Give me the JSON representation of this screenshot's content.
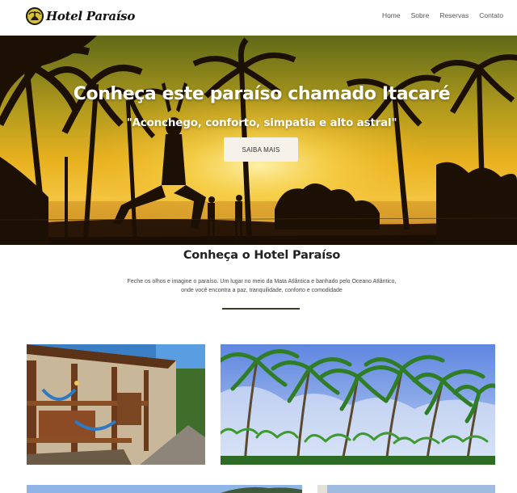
{
  "brand": {
    "name": "Hotel Paraíso",
    "logo_icon": "palm-tree-logo-icon"
  },
  "nav": {
    "items": [
      {
        "label": "Home"
      },
      {
        "label": "Sobre"
      },
      {
        "label": "Reservas"
      },
      {
        "label": "Contato"
      }
    ]
  },
  "hero": {
    "title": "Conheça este paraíso chamado Itacaré",
    "subtitle": "\"Aconchego, conforto, simpatia e alto astral\"",
    "button_label": "SAIBA MAIS"
  },
  "about": {
    "title": "Conheça o Hotel Paraíso",
    "text_line_1": "Feche os olhos e imagine o paraíso. Um lugar no meio da Mata Atlântica e banhado pelo Oceano Atlântico,",
    "text_line_2": "onde você encontra a paz, tranquilidade, conforto e comodidade"
  },
  "colors": {
    "hero_sky_top": "#6f7d1e",
    "hero_sun": "#f7d84a",
    "button_bg": "#f6f2ea",
    "divider": "#3d3a2a"
  }
}
